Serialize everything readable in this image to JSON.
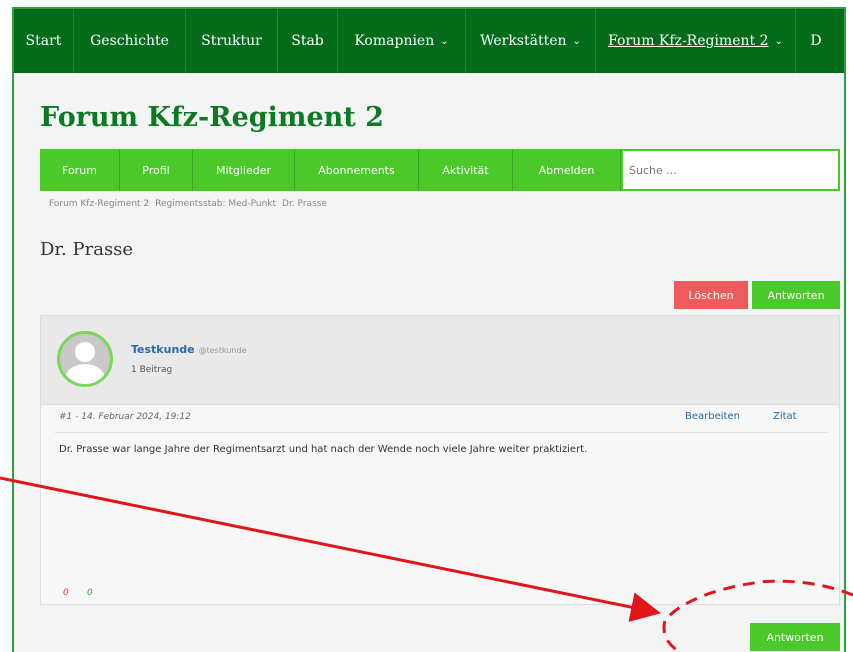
{
  "topnav": {
    "items": [
      {
        "label": "Start",
        "dropdown": false
      },
      {
        "label": "Geschichte",
        "dropdown": false
      },
      {
        "label": "Struktur",
        "dropdown": false
      },
      {
        "label": "Stab",
        "dropdown": false
      },
      {
        "label": "Komapnien",
        "dropdown": true
      },
      {
        "label": "Werkstätten",
        "dropdown": true
      },
      {
        "label": "Forum Kfz-Regiment 2",
        "dropdown": true
      },
      {
        "label": "D",
        "dropdown": false
      }
    ],
    "active_index": 6
  },
  "forum_title": "Forum Kfz-Regiment 2",
  "forum_nav": {
    "items": [
      "Forum",
      "Profil",
      "Mitglieder",
      "Abonnements",
      "Aktivität",
      "Abmelden"
    ],
    "search_placeholder": "Suche ..."
  },
  "breadcrumb": [
    "Forum Kfz-Regiment 2",
    "Regimentsstab: Med-Punkt",
    "Dr. Prasse"
  ],
  "topic_title": "Dr. Prasse",
  "actions": {
    "delete_label": "Löschen",
    "reply_label": "Antworten"
  },
  "post": {
    "author_name": "Testkunde",
    "author_handle": "@testkunde",
    "post_count": "1 Beitrag",
    "meta": "#1 - 14. Februar 2024, 19:12",
    "edit_label": "Bearbeiten",
    "quote_label": "Zitat",
    "body": "Dr. Prasse war lange Jahre der Regimentsarzt und hat nach der Wende noch viele Jahre weiter praktiziert.",
    "vote_down": "0",
    "vote_up": "0"
  },
  "colors": {
    "topnav_bg": "#046b1b",
    "forum_nav_bg": "#4bc82a",
    "title_green": "#0c7a23",
    "delete_red": "#ec5c5c",
    "annotation_red": "#e0161b"
  }
}
